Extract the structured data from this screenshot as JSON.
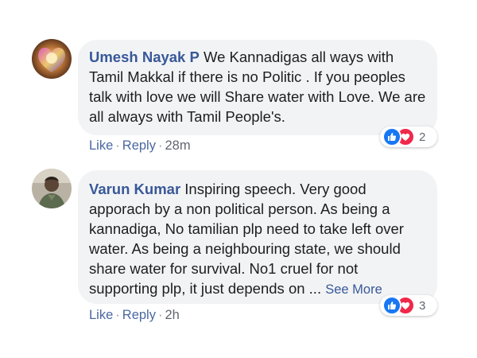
{
  "comments": [
    {
      "author": "Umesh Nayak P",
      "text": " We Kannadigas all ways with Tamil Makkal if there is no Politic . If you peoples talk with love we will Share water with Love. We are all always with Tamil People's.",
      "actions": {
        "like": "Like",
        "reply": "Reply",
        "sep": "·",
        "time": "28m"
      },
      "reactions": {
        "count": "2",
        "types": [
          "like-icon",
          "love-icon"
        ]
      },
      "avatar": "heart-avatar"
    },
    {
      "author": "Varun Kumar",
      "text": " Inspiring speech. Very good apporach by a non political person. As being a kannadiga, No tamilian plp need to take left over water. As being a neighbouring state, we should share water for survival. No1 cruel for not supporting plp, it just depends on ...",
      "see_more": "See More",
      "actions": {
        "like": "Like",
        "reply": "Reply",
        "sep": "·",
        "time": "2h"
      },
      "reactions": {
        "count": "3",
        "types": [
          "like-icon",
          "love-icon"
        ]
      },
      "avatar": "person-avatar"
    }
  ],
  "colors": {
    "link": "#385898",
    "bubble": "#f2f3f5",
    "like": "#1877f2",
    "love": "#f0284a"
  }
}
